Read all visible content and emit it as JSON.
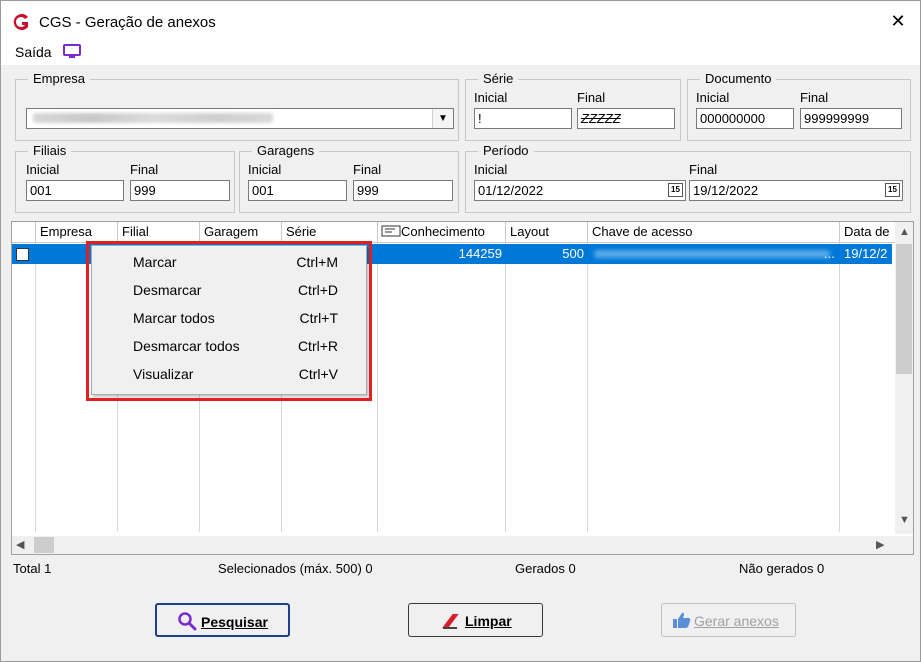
{
  "window": {
    "title": "CGS - Geração de anexos"
  },
  "menu": {
    "saida": "Saída",
    "monitor_icon": "monitor-icon"
  },
  "empresa": {
    "legend": "Empresa",
    "value": ""
  },
  "serie": {
    "legend": "Série",
    "inicial_label": "Inicial",
    "final_label": "Final",
    "inicial_value": "!",
    "final_value": "ZZZZZ"
  },
  "documento": {
    "legend": "Documento",
    "inicial_label": "Inicial",
    "final_label": "Final",
    "inicial_value": "000000000",
    "final_value": "999999999"
  },
  "filiais": {
    "legend": "Filiais",
    "inicial_label": "Inicial",
    "final_label": "Final",
    "inicial_value": "001",
    "final_value": "999"
  },
  "garagens": {
    "legend": "Garagens",
    "inicial_label": "Inicial",
    "final_label": "Final",
    "inicial_value": "001",
    "final_value": "999"
  },
  "periodo": {
    "legend": "Período",
    "inicial_label": "Inicial",
    "final_label": "Final",
    "inicial_value": "01/12/2022",
    "final_value": "19/12/2022",
    "calendar_glyph": "15"
  },
  "grid": {
    "columns": [
      "Empresa",
      "Filial",
      "Garagem",
      "Série",
      "Conhecimento",
      "Layout",
      "Chave de acesso",
      "Data de"
    ],
    "row": {
      "conhecimento": "144259",
      "layout": "500",
      "chave_suffix": "...",
      "data": "19/12/2"
    }
  },
  "context_menu": {
    "items": [
      {
        "label": "Marcar",
        "shortcut": "Ctrl+M"
      },
      {
        "label": "Desmarcar",
        "shortcut": "Ctrl+D"
      },
      {
        "label": "Marcar todos",
        "shortcut": "Ctrl+T"
      },
      {
        "label": "Desmarcar todos",
        "shortcut": "Ctrl+R"
      },
      {
        "label": "Visualizar",
        "shortcut": "Ctrl+V"
      }
    ]
  },
  "status": {
    "total": "Total 1",
    "selecionados": "Selecionados (máx. 500) 0",
    "gerados": "Gerados 0",
    "nao_gerados": "Não gerados 0"
  },
  "buttons": {
    "pesquisar": "Pesquisar",
    "limpar": "Limpar",
    "gerar": "Gerar anexos"
  },
  "colors": {
    "selection": "#0078d7",
    "highlight": "#e02020",
    "logo": "#c8102e",
    "monitor": "#7a2bd0"
  }
}
